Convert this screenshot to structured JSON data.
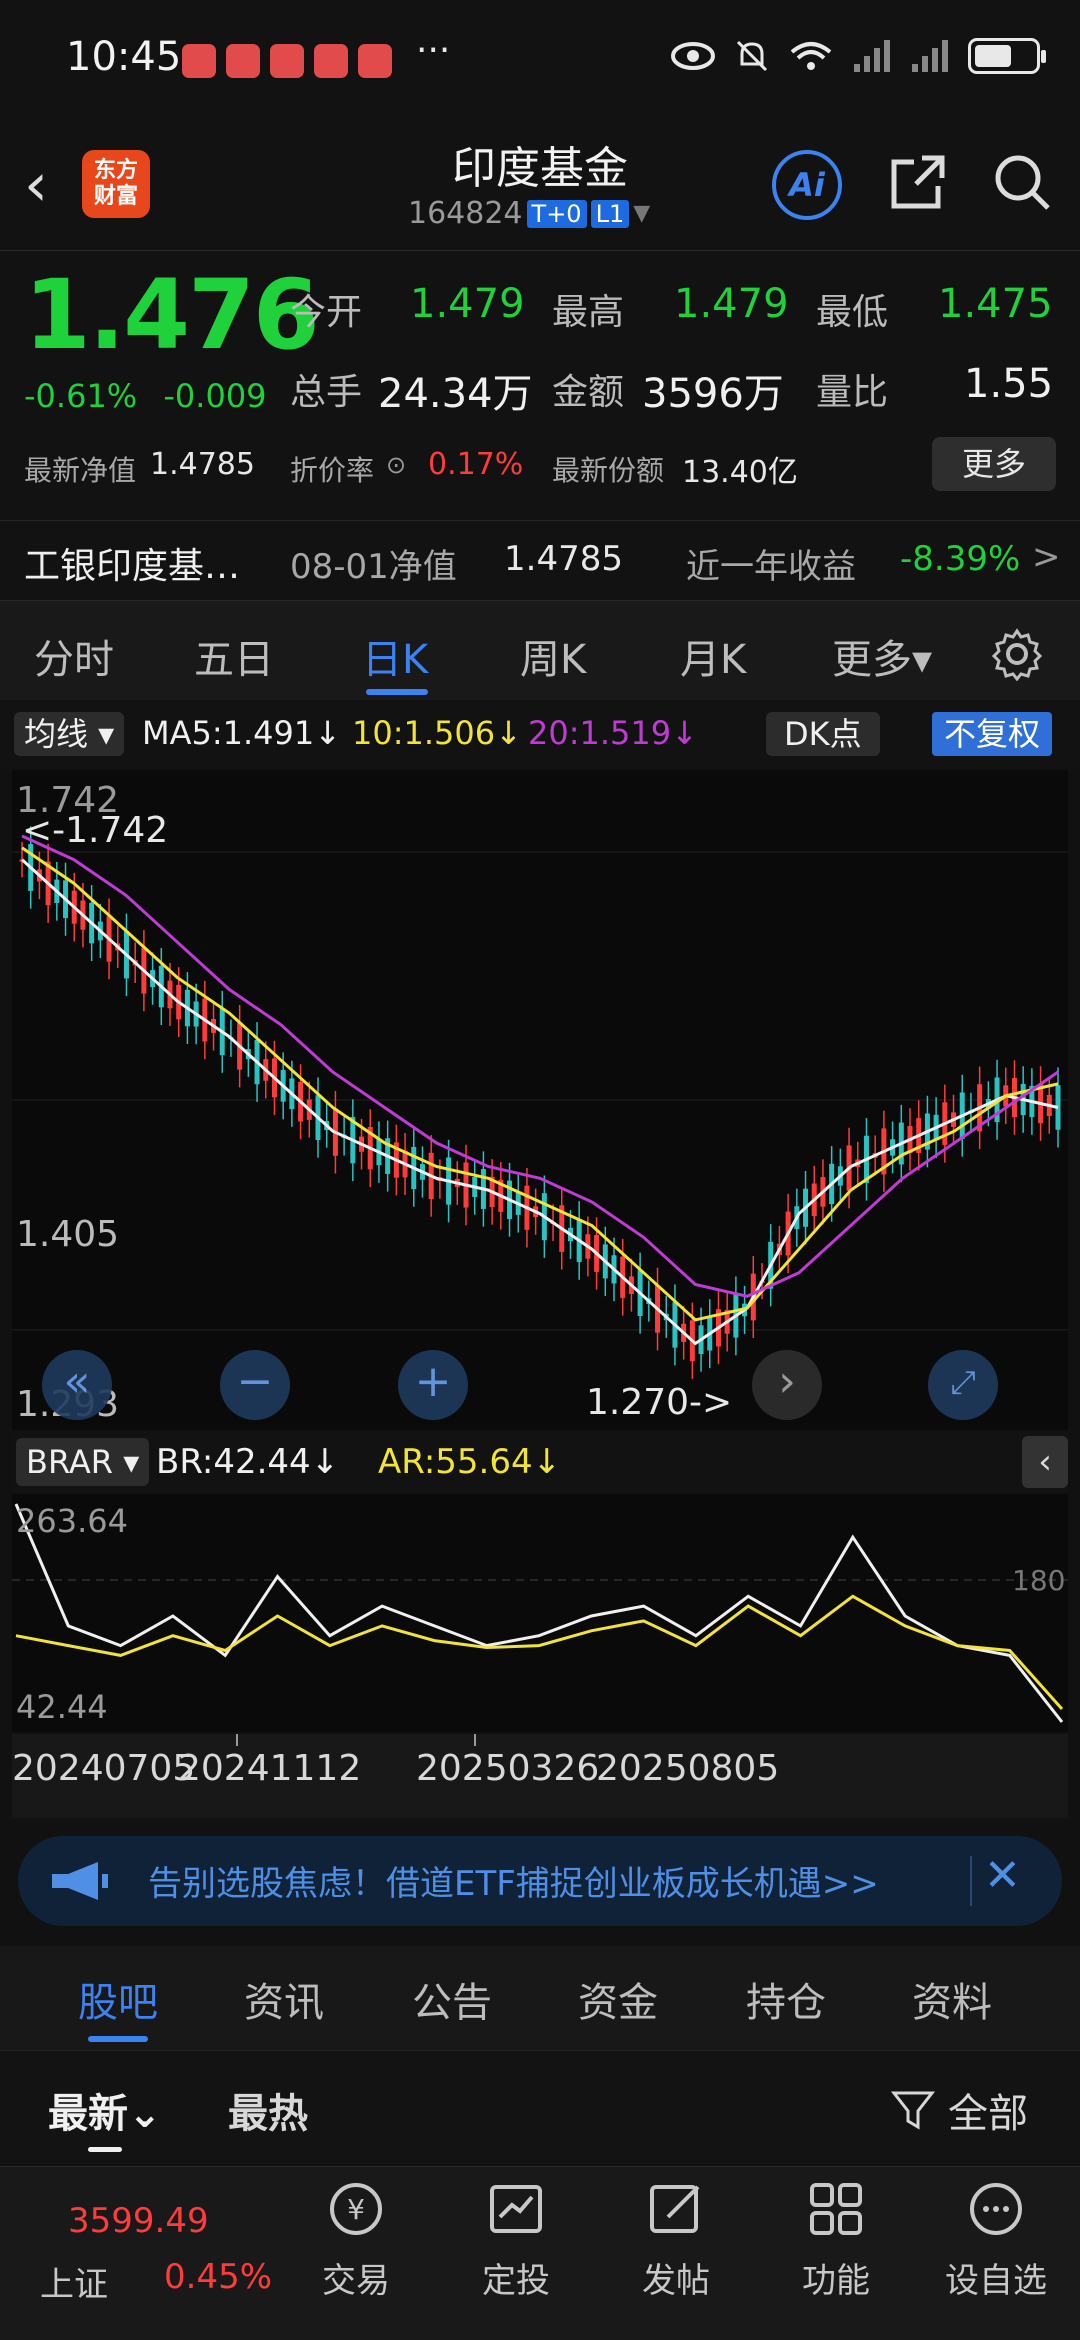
{
  "status_bar": {
    "time": "10:45",
    "more": "···"
  },
  "header": {
    "back_icon": "chevron-left",
    "logo_text_1": "东方",
    "logo_text_2": "财富",
    "title": "印度基金",
    "code": "164824",
    "tag_t0": "T+0",
    "tag_l1": "L1",
    "ai_label": "Ai"
  },
  "quote": {
    "price": "1.476",
    "change_pct": "-0.61%",
    "change_abs": "-0.009",
    "open_label": "今开",
    "open_value": "1.479",
    "high_label": "最高",
    "high_value": "1.479",
    "low_label": "最低",
    "low_value": "1.475",
    "volume_label": "总手",
    "volume_value": "24.34万",
    "amount_label": "金额",
    "amount_value": "3596万",
    "vol_ratio_label": "量比",
    "vol_ratio_value": "1.55",
    "nav_label": "最新净值",
    "nav_value": "1.4785",
    "discount_label": "折价率",
    "discount_value": "0.17%",
    "shares_label": "最新份额",
    "shares_value": "13.40亿",
    "more_button": "更多"
  },
  "fund_row": {
    "name": "工银印度基…",
    "nav_date_label": "08-01净值",
    "nav_value": "1.4785",
    "yearly_label": "近一年收益",
    "yearly_value": "-8.39%",
    "arrow": ">"
  },
  "period_tabs": [
    "分时",
    "五日",
    "日K",
    "周K",
    "月K",
    "更多▾"
  ],
  "indicator_bar": {
    "ma_select": "均线 ▾",
    "ma5": "MA5:1.491↓",
    "ma10": "10:1.506↓",
    "ma20": "20:1.519↓",
    "dk_button": "DK点",
    "fq_button": "不复权"
  },
  "main_chart": {
    "max_label": "1.742",
    "max_marker": "<-1.742",
    "mid_label": "1.405",
    "low_label": "1.293",
    "min_marker": "1.270->"
  },
  "sub_chart": {
    "select": "BRAR ▾",
    "br": "BR:42.44↓",
    "ar": "AR:55.64↓",
    "top_label": "263.64",
    "mid_label": "180",
    "bottom_label": "42.44"
  },
  "dates": [
    "20240705",
    "20241112",
    "20250326",
    "20250805"
  ],
  "banner": {
    "text": "告别选股焦虑！借道ETF捕捉创业板成长机遇>>"
  },
  "bottom_tabs": [
    "股吧",
    "资讯",
    "公告",
    "资金",
    "持仓",
    "资料"
  ],
  "feed": {
    "latest": "最新⌄",
    "hot": "最热",
    "filter": "全部"
  },
  "bottom_nav": {
    "index_value": "3599.49",
    "index_name": "上证",
    "index_change": "0.45%",
    "items": [
      "交易",
      "定投",
      "发帖",
      "功能",
      "设自选"
    ]
  },
  "colors": {
    "down_green": "#1fd13a",
    "up_red": "#ff3b3b",
    "accent_blue": "#3c82f0",
    "ma10_yellow": "#f2e33a",
    "ma20_magenta": "#c03ad6"
  },
  "chart_data": [
    {
      "type": "line",
      "title": "",
      "series": [
        {
          "name": "MA5",
          "values": [
            1.7,
            1.66,
            1.62,
            1.58,
            1.55,
            1.51,
            1.47,
            1.45,
            1.43,
            1.42,
            1.4,
            1.37,
            1.33,
            1.29,
            1.32,
            1.4,
            1.44,
            1.46,
            1.48,
            1.5,
            1.49
          ]
        },
        {
          "name": "10",
          "values": [
            1.71,
            1.68,
            1.64,
            1.6,
            1.57,
            1.53,
            1.49,
            1.46,
            1.44,
            1.43,
            1.41,
            1.39,
            1.35,
            1.31,
            1.32,
            1.37,
            1.42,
            1.45,
            1.47,
            1.5,
            1.51
          ]
        },
        {
          "name": "20",
          "values": [
            1.72,
            1.7,
            1.67,
            1.63,
            1.59,
            1.56,
            1.52,
            1.49,
            1.46,
            1.44,
            1.43,
            1.41,
            1.38,
            1.34,
            1.33,
            1.35,
            1.39,
            1.43,
            1.46,
            1.49,
            1.52
          ]
        }
      ],
      "ylim": [
        1.293,
        1.742
      ],
      "xlim": [
        "20240705",
        "20250805"
      ]
    },
    {
      "type": "line",
      "series": [
        {
          "name": "BR",
          "values": [
            263.64,
            140,
            120,
            150,
            110,
            190,
            130,
            160,
            140,
            120,
            130,
            150,
            160,
            130,
            170,
            140,
            230,
            150,
            120,
            110,
            42.44
          ]
        },
        {
          "name": "AR",
          "values": [
            130,
            120,
            110,
            130,
            115,
            150,
            120,
            140,
            125,
            118,
            120,
            135,
            145,
            120,
            160,
            130,
            170,
            140,
            120,
            115,
            55.64
          ]
        }
      ],
      "ylim": [
        42.44,
        263.64
      ]
    }
  ]
}
